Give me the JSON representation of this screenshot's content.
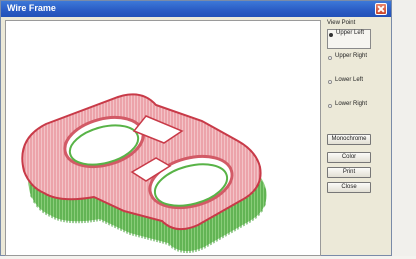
{
  "window": {
    "title": "Wire Frame"
  },
  "view_point": {
    "label": "View Point",
    "options": [
      {
        "label": "Upper Left",
        "selected": true
      },
      {
        "label": "Upper Right",
        "selected": false
      },
      {
        "label": "Lower Left",
        "selected": false
      },
      {
        "label": "Lower Right",
        "selected": false
      }
    ]
  },
  "buttons": {
    "monochrome": "Monochrome",
    "color": "Color",
    "print": "Print",
    "close": "Close"
  },
  "colors": {
    "top_surface": "#e0707a",
    "bottom_surface": "#55b545"
  }
}
